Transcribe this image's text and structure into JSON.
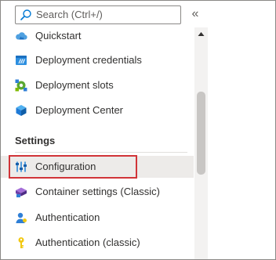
{
  "search": {
    "placeholder": "Search (Ctrl+/)",
    "icon": "search-icon"
  },
  "collapse": {
    "glyph": "«"
  },
  "menu": {
    "items_top": [
      {
        "label": "Quickstart",
        "icon": "quickstart-cloud-icon"
      },
      {
        "label": "Deployment credentials",
        "icon": "deployment-credentials-icon"
      },
      {
        "label": "Deployment slots",
        "icon": "deployment-slots-icon"
      },
      {
        "label": "Deployment Center",
        "icon": "deployment-center-cube-icon"
      }
    ],
    "section_settings": "Settings",
    "items_settings": [
      {
        "label": "Configuration",
        "icon": "configuration-sliders-icon",
        "selected": true
      },
      {
        "label": "Container settings (Classic)",
        "icon": "container-settings-icon"
      },
      {
        "label": "Authentication",
        "icon": "authentication-person-icon"
      },
      {
        "label": "Authentication (classic)",
        "icon": "authentication-key-icon"
      }
    ]
  },
  "colors": {
    "highlight": "#d13438",
    "selected_bg": "#edebe9",
    "accent": "#0078d4"
  }
}
